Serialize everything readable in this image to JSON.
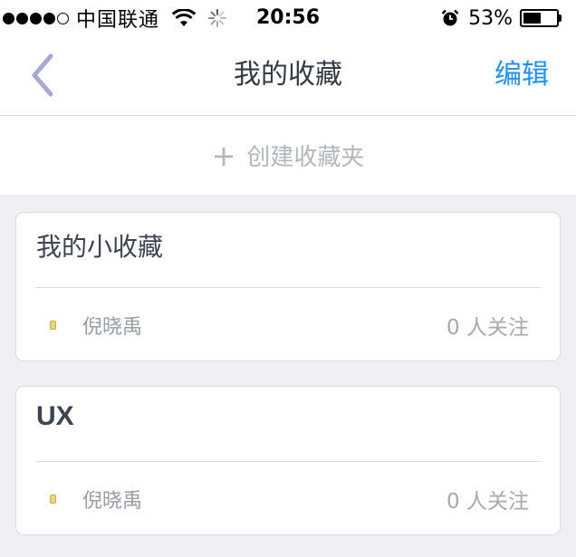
{
  "status_bar": {
    "carrier": "中国联通",
    "time": "20:56",
    "battery_percent": "53%",
    "signal_bars_filled": 4,
    "signal_bars_total": 5,
    "battery_level": 0.53
  },
  "nav": {
    "title": "我的收藏",
    "edit_label": "编辑",
    "back_icon": "chevron-left-icon",
    "accent_color": "#1e90ff"
  },
  "create_folder": {
    "icon": "+",
    "label": "创建收藏夹"
  },
  "collections": [
    {
      "title": "我的小收藏",
      "owner": "倪晓禹",
      "followers": "0 人关注"
    },
    {
      "title": "UX",
      "owner": "倪晓禹",
      "followers": "0 人关注"
    }
  ]
}
